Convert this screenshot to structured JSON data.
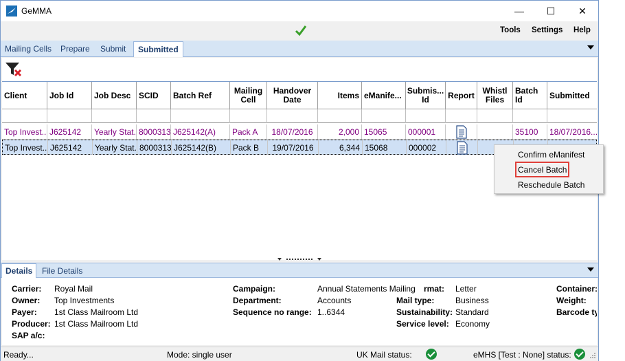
{
  "window": {
    "title": "GeMMA",
    "minimize_glyph": "—",
    "maximize_glyph": "☐",
    "close_glyph": "✕"
  },
  "menu": {
    "tools": "Tools",
    "settings": "Settings",
    "help": "Help"
  },
  "tabs": [
    {
      "label": "Mailing Cells"
    },
    {
      "label": "Prepare"
    },
    {
      "label": "Submit"
    },
    {
      "label": "Submitted"
    }
  ],
  "grid": {
    "headers": {
      "client": "Client",
      "job_id": "Job Id",
      "job_desc": "Job Desc",
      "scid": "SCID",
      "batch_ref": "Batch Ref",
      "mailing_cell": "Mailing Cell",
      "handover_date": "Handover Date",
      "items": "Items",
      "emanifest": "eManife...",
      "submission_id": "Submis... Id",
      "report": "Report",
      "whistl_files": "Whistl Files",
      "batch_id": "Batch Id",
      "submitted": "Submitted"
    },
    "rows": [
      {
        "client": "Top Invest...",
        "job_id": "J625142",
        "job_desc": "Yearly Stat...",
        "scid": "8000313",
        "batch_ref": "J625142(A)",
        "mailing_cell": "Pack A",
        "handover_date": "18/07/2016",
        "items": "2,000",
        "emanifest": "15065",
        "submission_id": "000001",
        "batch_id": "35100",
        "submitted": "18/07/2016..."
      },
      {
        "client": "Top Invest...",
        "job_id": "J625142",
        "job_desc": "Yearly Stat...",
        "scid": "8000313",
        "batch_ref": "J625142(B)",
        "mailing_cell": "Pack B",
        "handover_date": "19/07/2016",
        "items": "6,344",
        "emanifest": "15068",
        "submission_id": "000002",
        "batch_id": "",
        "submitted": ""
      }
    ]
  },
  "context_menu": {
    "items": [
      "Confirm eManifest",
      "Cancel Batch",
      "Reschedule Batch"
    ]
  },
  "detail_tabs": [
    {
      "label": "Details"
    },
    {
      "label": "File Details"
    }
  ],
  "details": {
    "carrier_label": "Carrier:",
    "carrier": "Royal Mail",
    "owner_label": "Owner:",
    "owner": "Top Investments",
    "payer_label": "Payer:",
    "payer": "1st Class Mailroom Ltd",
    "producer_label": "Producer:",
    "producer": "1st Class Mailroom Ltd",
    "sap_label": "SAP a/c:",
    "campaign_label": "Campaign:",
    "campaign": "Annual Statements Mailing",
    "department_label": "Department:",
    "department": "Accounts",
    "sequence_label": "Sequence no range:",
    "sequence": "1..6344",
    "format_label": "rmat:",
    "format": "Letter",
    "mail_type_label": "Mail type:",
    "mail_type": "Business",
    "sustainability_label": "Sustainability:",
    "sustainability": "Standard",
    "service_level_label": "Service level:",
    "service_level": "Economy",
    "container_label": "Container:",
    "weight_label": "Weight:",
    "barcode_label": "Barcode ty"
  },
  "status": {
    "ready": "Ready...",
    "mode": "Mode: single user",
    "uk_mail": "UK Mail status:",
    "emhs": "eMHS [Test : None] status:"
  }
}
